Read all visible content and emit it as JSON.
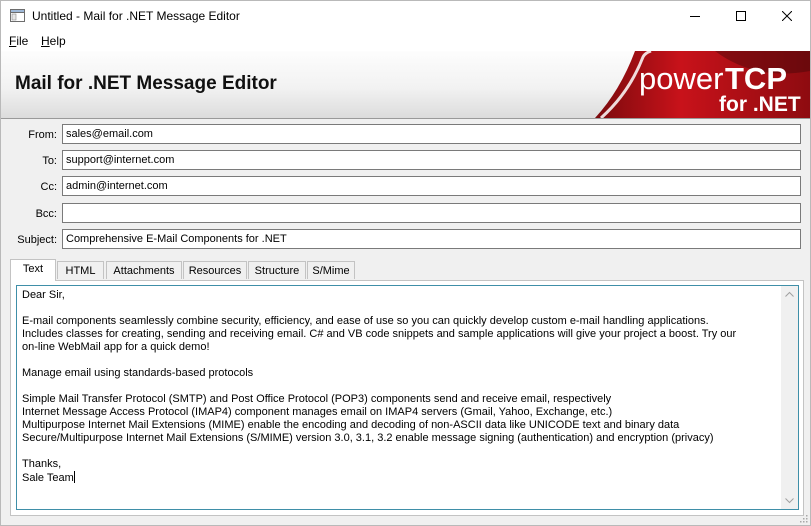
{
  "window": {
    "title": "Untitled - Mail for .NET Message Editor"
  },
  "menu": {
    "file": {
      "accel": "F",
      "rest": "ile"
    },
    "help": {
      "accel": "H",
      "rest": "elp"
    }
  },
  "banner": {
    "title": "Mail for .NET Message Editor",
    "logo_word1": "power",
    "logo_word2": "TCP",
    "logo_word3": "for .NET"
  },
  "form": {
    "from": {
      "label": "From:",
      "value": "sales@email.com"
    },
    "to": {
      "label": "To:",
      "value": "support@internet.com"
    },
    "cc": {
      "label": "Cc:",
      "value": "admin@internet.com"
    },
    "bcc": {
      "label": "Bcc:",
      "value": ""
    },
    "subject": {
      "label": "Subject:",
      "value": "Comprehensive E-Mail Components for .NET"
    }
  },
  "tabs": [
    "Text",
    "HTML",
    "Attachments",
    "Resources",
    "Structure",
    "S/Mime"
  ],
  "active_tab": "Text",
  "message_body": "Dear Sir,\n\nE-mail components seamlessly combine security, efficiency, and ease of use so you can quickly develop custom e-mail handling applications.\nIncludes classes for creating, sending and receiving email. C# and VB code snippets and sample applications will give your project a boost. Try our\non-line WebMail app for a quick demo!\n\nManage email using standards-based protocols\n\nSimple Mail Transfer Protocol (SMTP) and Post Office Protocol (POP3) components send and receive email, respectively\nInternet Message Access Protocol (IMAP4) component manages email on IMAP4 servers (Gmail, Yahoo, Exchange, etc.)\nMultipurpose Internet Mail Extensions (MIME) enable the encoding and decoding of non-ASCII data like UNICODE text and binary data\nSecure/Multipurpose Internet Mail Extensions (S/MIME) version 3.0, 3.1, 3.2 enable message signing (authentication) and encryption (privacy)\n\nThanks,\nSale Team",
  "icons": {
    "app": "app-window-icon",
    "minimize": "minimize-icon",
    "maximize": "maximize-icon",
    "close": "close-icon"
  },
  "colors": {
    "logo_red": "#c8121a",
    "logo_dark": "#2a0607",
    "field_border": "#7a7a7a",
    "focus_border": "#3f8fa8"
  }
}
